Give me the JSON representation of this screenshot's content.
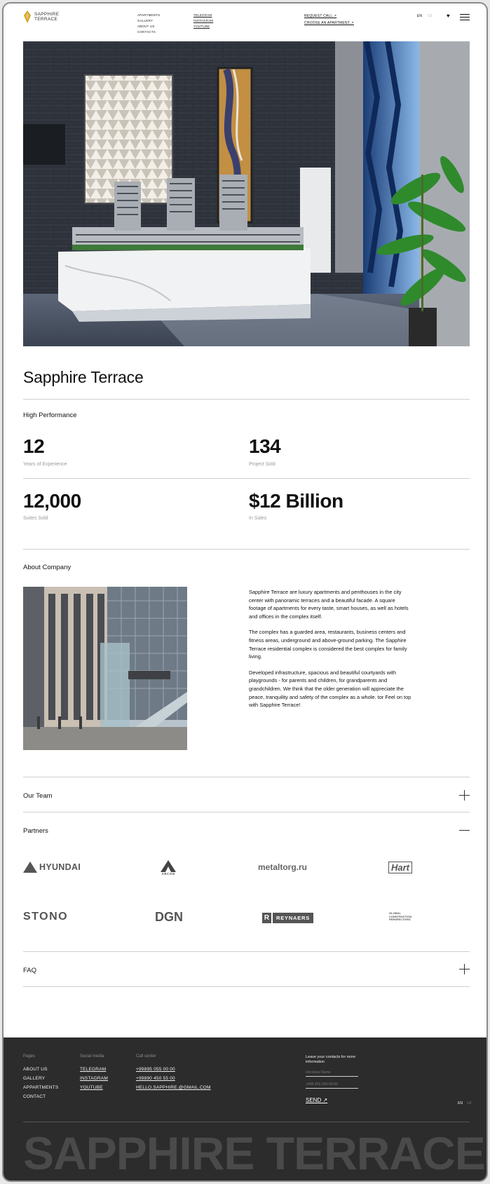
{
  "brand": {
    "line1": "SAPPHIRE",
    "line2": "TERRACE"
  },
  "nav": {
    "pages": [
      "APARTMENTS",
      "GALLERY",
      "ABOUT US",
      "CONTACTS"
    ],
    "social": [
      "TELEGRAM",
      "INSTAGRAM",
      "YOUTUBE"
    ],
    "request_call": "REQUEST CALL ↗",
    "choose_apartment": "CHOOSE AN APARTMENT ↗",
    "lang_active": "EN",
    "lang_other": "UZ"
  },
  "page_title": "Sapphire Terrace",
  "performance": {
    "label": "High Performance",
    "stats": [
      {
        "value": "12",
        "label": "Years of Experience"
      },
      {
        "value": "134",
        "label": "Project Sold"
      },
      {
        "value": "12,000",
        "label": "Suites Sold"
      },
      {
        "value": "$12 Billion",
        "label": "In Sales"
      }
    ]
  },
  "about": {
    "label": "About Company",
    "paragraphs": [
      "Sapphire Terrace are luxury apartments and penthouses in the city center with panoramic terraces and a beautiful facade. A square footage of apartments for every taste, smart houses, as well as hotels and offices in the complex itself.",
      "The complex has a guarded area, restaurants, business centers and fitness areas, underground and above-ground parking. The Sapphire Terrace residential complex is considered the best complex for family living.",
      "Developed infrastructure, spacious and beautiful courtyards with playgrounds - for parents and children, for grandparents and grandchildren. We think that the older generation will appreciate the peace, tranquility and safety of the complex as a whole. tor Feel on top with Sapphire Terrace!"
    ]
  },
  "accordion": {
    "team": "Our Team",
    "partners": "Partners",
    "faq": "FAQ"
  },
  "partners": [
    "HYUNDAI",
    "ARCON",
    "metaltorg.ru",
    "Hart",
    "STONO",
    "DGN",
    "REYNAERS",
    "GLOBAL CONSTRUCTION PERSPECTIVES"
  ],
  "footer": {
    "pages_heading": "Pages",
    "pages": [
      "ABOUT US",
      "GALLERY",
      "APPARTMENTS",
      "CONTACT"
    ],
    "social_heading": "Social media",
    "social": [
      "TELEGRAM",
      "INSTAGRAM",
      "YOUTUBE"
    ],
    "call_heading": "Call center",
    "phones": [
      "+99895 055 00 00",
      "+99890 450 55 00"
    ],
    "email": "HELLO.SAPPHIRE.@GMAIL.COM",
    "form_lead": "Leave your contacts for more information",
    "name_placeholder": "Introduce Name",
    "phone_placeholder": "+998 (00) 000-00-00",
    "send": "SEND ↗",
    "lang_active": "EN",
    "lang_other": "UZ",
    "big_brand": "SAPPHIRE TERRACE"
  },
  "colors": {
    "footer_bg": "#2c2c2c",
    "logo_gold": "#d4a017"
  }
}
